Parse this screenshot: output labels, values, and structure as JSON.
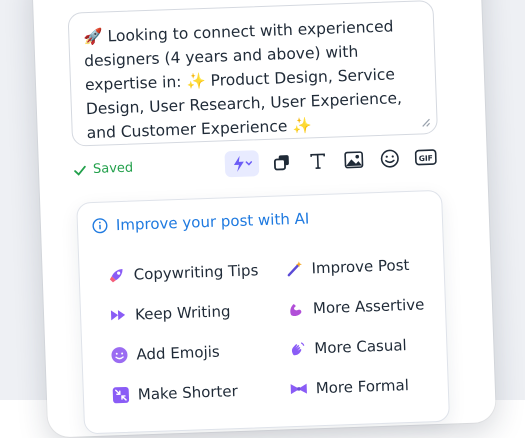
{
  "composer": {
    "text": "🚀 Looking to connect with experienced designers (4 years and above) with expertise in: ✨ Product Design, Service Design, User Research, User Experience, and Customer Experience ✨"
  },
  "status": {
    "saved_label": "Saved",
    "color": "#22a04b"
  },
  "toolbar": {
    "tools": [
      "ai-lightning-icon",
      "copy-icon",
      "text-format-icon",
      "image-icon",
      "emoji-icon",
      "gif-icon"
    ],
    "gif_label": "GIF",
    "text_glyph": "T"
  },
  "ai_panel": {
    "title": "Improve your post with AI",
    "accent": "#1f7ae0",
    "options": [
      {
        "label": "Copywriting Tips",
        "icon": "rocket-icon"
      },
      {
        "label": "Improve Post",
        "icon": "magic-wand-icon"
      },
      {
        "label": "Keep Writing",
        "icon": "fast-forward-icon"
      },
      {
        "label": "More Assertive",
        "icon": "flexed-arm-icon"
      },
      {
        "label": "Add Emojis",
        "icon": "smiling-face-icon"
      },
      {
        "label": "More Casual",
        "icon": "waving-hand-icon"
      },
      {
        "label": "Make Shorter",
        "icon": "shrink-icon"
      },
      {
        "label": "More Formal",
        "icon": "bow-tie-icon"
      }
    ]
  }
}
